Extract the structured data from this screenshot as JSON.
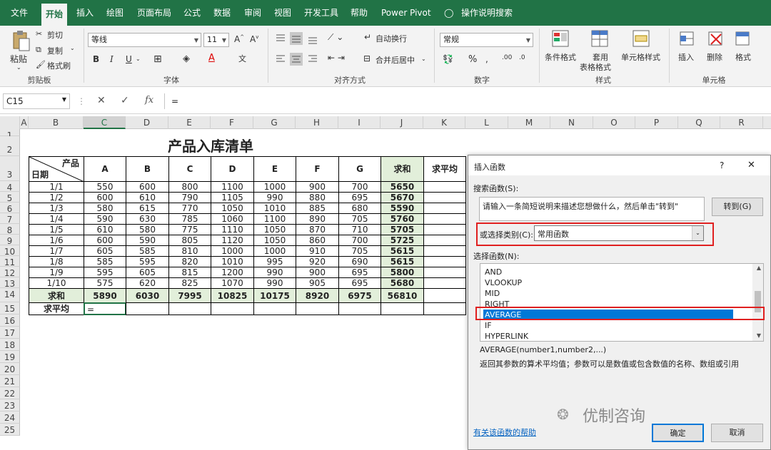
{
  "tabs": [
    "文件",
    "开始",
    "插入",
    "绘图",
    "页面布局",
    "公式",
    "数据",
    "审阅",
    "视图",
    "开发工具",
    "帮助",
    "Power Pivot"
  ],
  "tell_me": "操作说明搜索",
  "ribbon": {
    "clipboard": {
      "paste": "粘贴",
      "cut": "剪切",
      "copy": "复制",
      "format_painter": "格式刷",
      "label": "剪贴板"
    },
    "font": {
      "name": "等线",
      "size": "11",
      "bold": "B",
      "italic": "I",
      "underline": "U",
      "label": "字体"
    },
    "alignment": {
      "wrap": "自动换行",
      "merge": "合并后居中",
      "label": "对齐方式"
    },
    "number": {
      "format": "常规",
      "percent": "%",
      "label": "数字"
    },
    "styles": {
      "conditional": "条件格式",
      "table": "套用",
      "table2": "表格格式",
      "cell_styles": "单元格样式",
      "label": "样式"
    },
    "cells": {
      "insert": "插入",
      "delete": "删除",
      "format": "格式",
      "label": "单元格"
    }
  },
  "formula_bar": {
    "name_box": "C15",
    "fx": "fx",
    "content": "="
  },
  "columns": [
    "A",
    "B",
    "C",
    "D",
    "E",
    "F",
    "G",
    "H",
    "I",
    "J",
    "K",
    "L",
    "M",
    "N",
    "O",
    "P",
    "Q",
    "R"
  ],
  "rows": [
    "1",
    "2",
    "3",
    "4",
    "5",
    "6",
    "7",
    "8",
    "9",
    "10",
    "11",
    "12",
    "13",
    "14",
    "15",
    "16",
    "17",
    "18",
    "19",
    "20",
    "21",
    "22",
    "23",
    "24",
    "25"
  ],
  "sheet": {
    "title": "产品入库清单",
    "corner_top": "产品",
    "corner_bottom": "日期",
    "headers": [
      "A",
      "B",
      "C",
      "D",
      "E",
      "F",
      "G",
      "求和",
      "求平均"
    ],
    "data": [
      [
        "1/1",
        "550",
        "600",
        "800",
        "1100",
        "1000",
        "900",
        "700",
        "5650"
      ],
      [
        "1/2",
        "600",
        "610",
        "790",
        "1105",
        "990",
        "880",
        "695",
        "5670"
      ],
      [
        "1/3",
        "580",
        "615",
        "770",
        "1050",
        "1010",
        "885",
        "680",
        "5590"
      ],
      [
        "1/4",
        "590",
        "630",
        "785",
        "1060",
        "1100",
        "890",
        "705",
        "5760"
      ],
      [
        "1/5",
        "610",
        "580",
        "775",
        "1110",
        "1050",
        "870",
        "710",
        "5705"
      ],
      [
        "1/6",
        "600",
        "590",
        "805",
        "1120",
        "1050",
        "860",
        "700",
        "5725"
      ],
      [
        "1/7",
        "605",
        "585",
        "810",
        "1000",
        "1000",
        "910",
        "705",
        "5615"
      ],
      [
        "1/8",
        "585",
        "595",
        "820",
        "1010",
        "995",
        "920",
        "690",
        "5615"
      ],
      [
        "1/9",
        "595",
        "605",
        "815",
        "1200",
        "990",
        "900",
        "695",
        "5800"
      ],
      [
        "1/10",
        "575",
        "620",
        "825",
        "1070",
        "990",
        "905",
        "695",
        "5680"
      ]
    ],
    "sum_row": [
      "求和",
      "5890",
      "6030",
      "7995",
      "10825",
      "10175",
      "8920",
      "6975",
      "56810"
    ],
    "avg_label": "求平均",
    "avg_entry": "="
  },
  "dialog": {
    "title": "插入函数",
    "help": "?",
    "close": "✕",
    "search_label": "搜索函数(S):",
    "search_text": "请输入一条简短说明来描述您想做什么，然后单击\"转到\"",
    "go": "转到(G)",
    "category_label": "或选择类别(C):",
    "category": "常用函数",
    "select_label": "选择函数(N):",
    "functions": [
      "AND",
      "VLOOKUP",
      "MID",
      "RIGHT",
      "AVERAGE",
      "IF",
      "HYPERLINK"
    ],
    "selected": "AVERAGE",
    "signature": "AVERAGE(number1,number2,...)",
    "description": "返回其参数的算术平均值；参数可以是数值或包含数值的名称、数组或引用",
    "help_link": "有关该函数的帮助",
    "ok": "确定",
    "cancel": "取消"
  },
  "watermark": "优制咨询",
  "colors": {
    "excel_green": "#217346",
    "highlight": "#e2efda",
    "selection": "#0078d7",
    "red_box": "#e02020"
  }
}
